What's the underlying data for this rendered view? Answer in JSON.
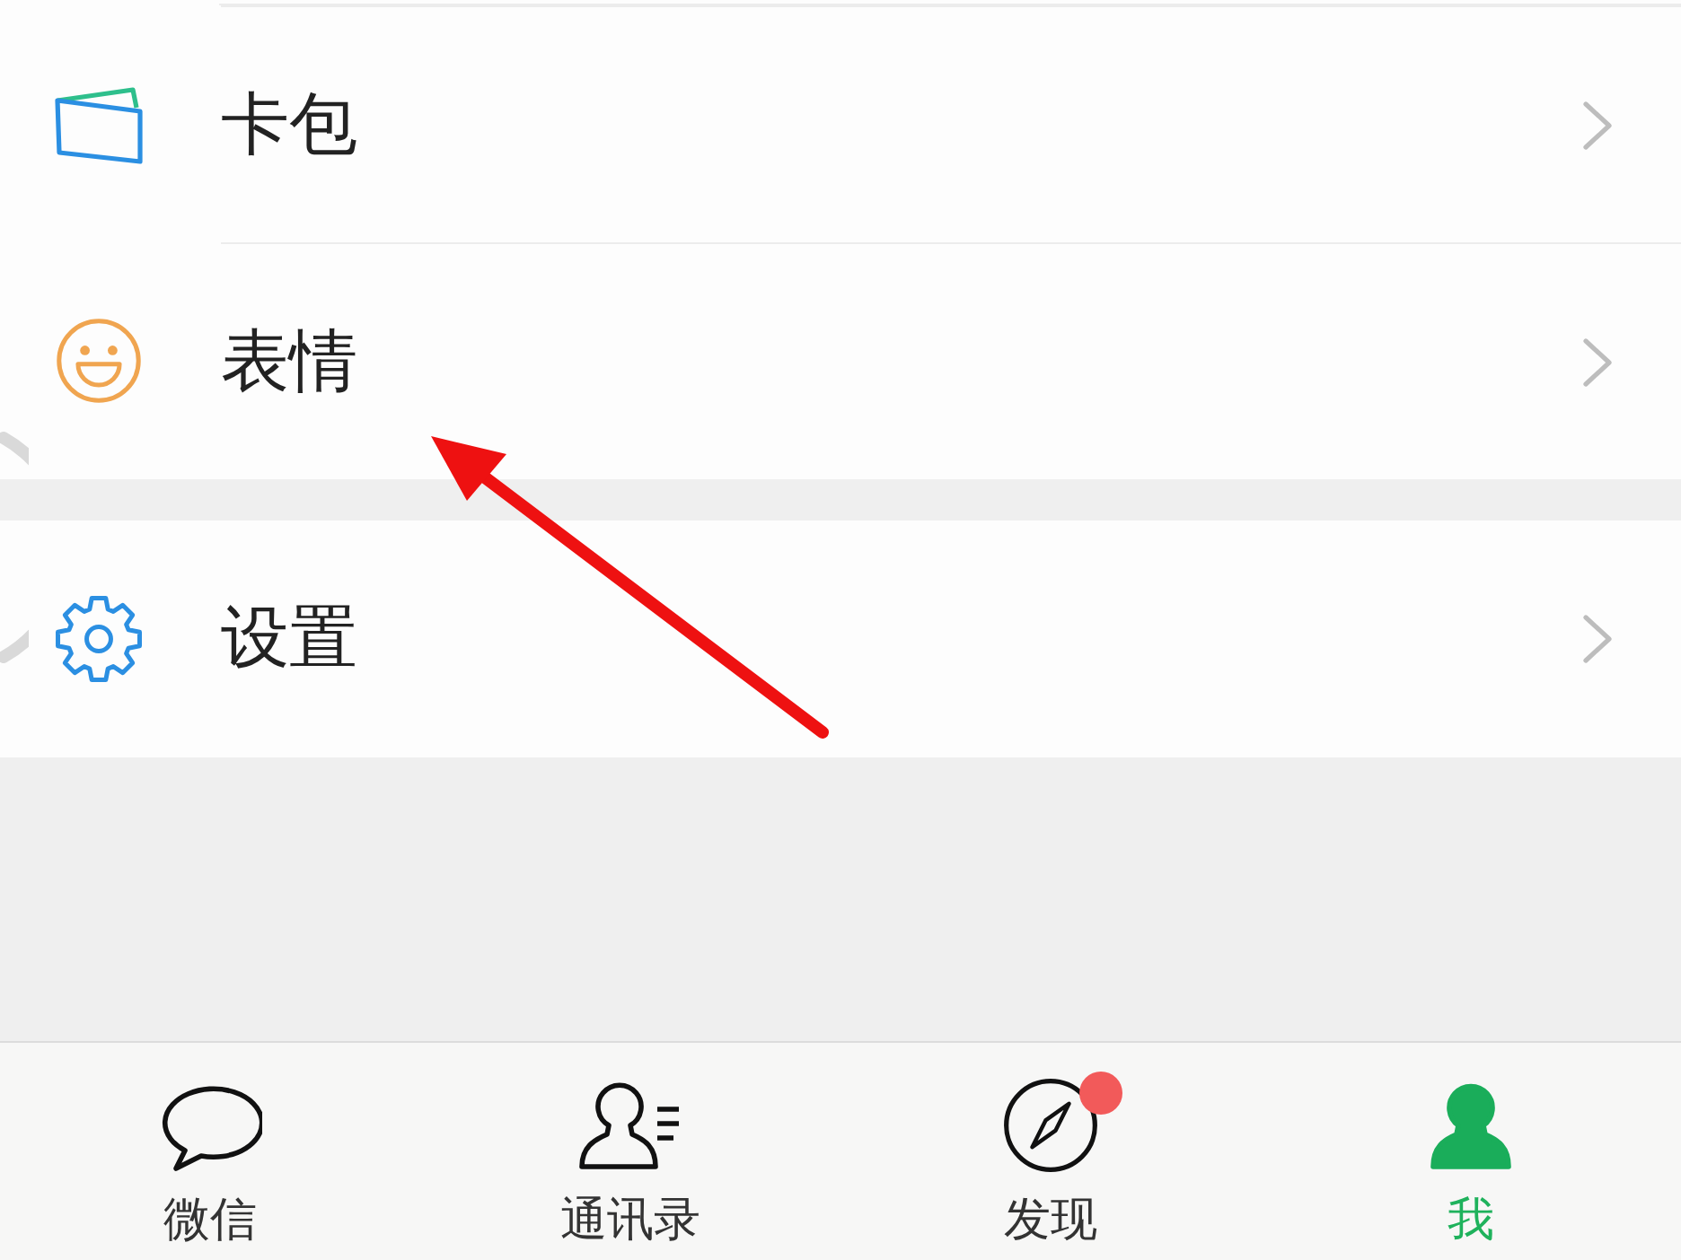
{
  "sections": [
    {
      "items": [
        {
          "label": "卡包",
          "kind": "wallet"
        },
        {
          "label": "表情",
          "kind": "emoji"
        }
      ]
    },
    {
      "items": [
        {
          "label": "设置",
          "kind": "settings"
        }
      ]
    }
  ],
  "tab_bar": {
    "tabs": [
      {
        "label": "微信",
        "kind": "chat",
        "selected": false,
        "badge": false
      },
      {
        "label": "通讯录",
        "kind": "contacts",
        "selected": false,
        "badge": false
      },
      {
        "label": "发现",
        "kind": "discover",
        "selected": false,
        "badge": true
      },
      {
        "label": "我",
        "kind": "me",
        "selected": true,
        "badge": false
      }
    ]
  }
}
